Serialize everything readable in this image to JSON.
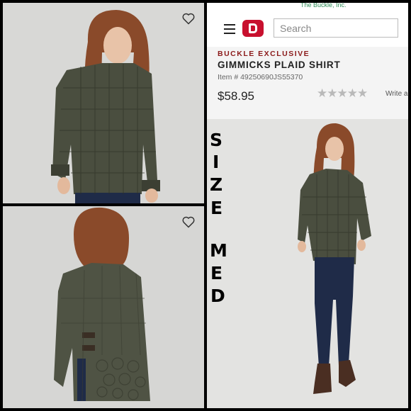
{
  "top_link": "The Buckle, Inc.",
  "search": {
    "placeholder": "Search"
  },
  "product": {
    "badge": "BUCKLE EXCLUSIVE",
    "title": "GIMMICKS PLAID SHIRT",
    "item_number": "Item # 49250690JS55370",
    "price": "$58.95",
    "rating_stars": "★★★★★",
    "write_review": "Write a"
  },
  "overlay": {
    "size_letters": [
      "S",
      "I",
      "Z",
      "E"
    ],
    "med_letters": [
      "M",
      "E",
      "D"
    ]
  },
  "colors": {
    "brand": "#c8102e",
    "exclusive": "#8b1a1a",
    "shirt": "#4a4e3f",
    "jeans": "#1f2b48"
  },
  "icons": [
    "heart-icon",
    "hamburger-icon",
    "buckle-logo-icon",
    "star-icon"
  ]
}
